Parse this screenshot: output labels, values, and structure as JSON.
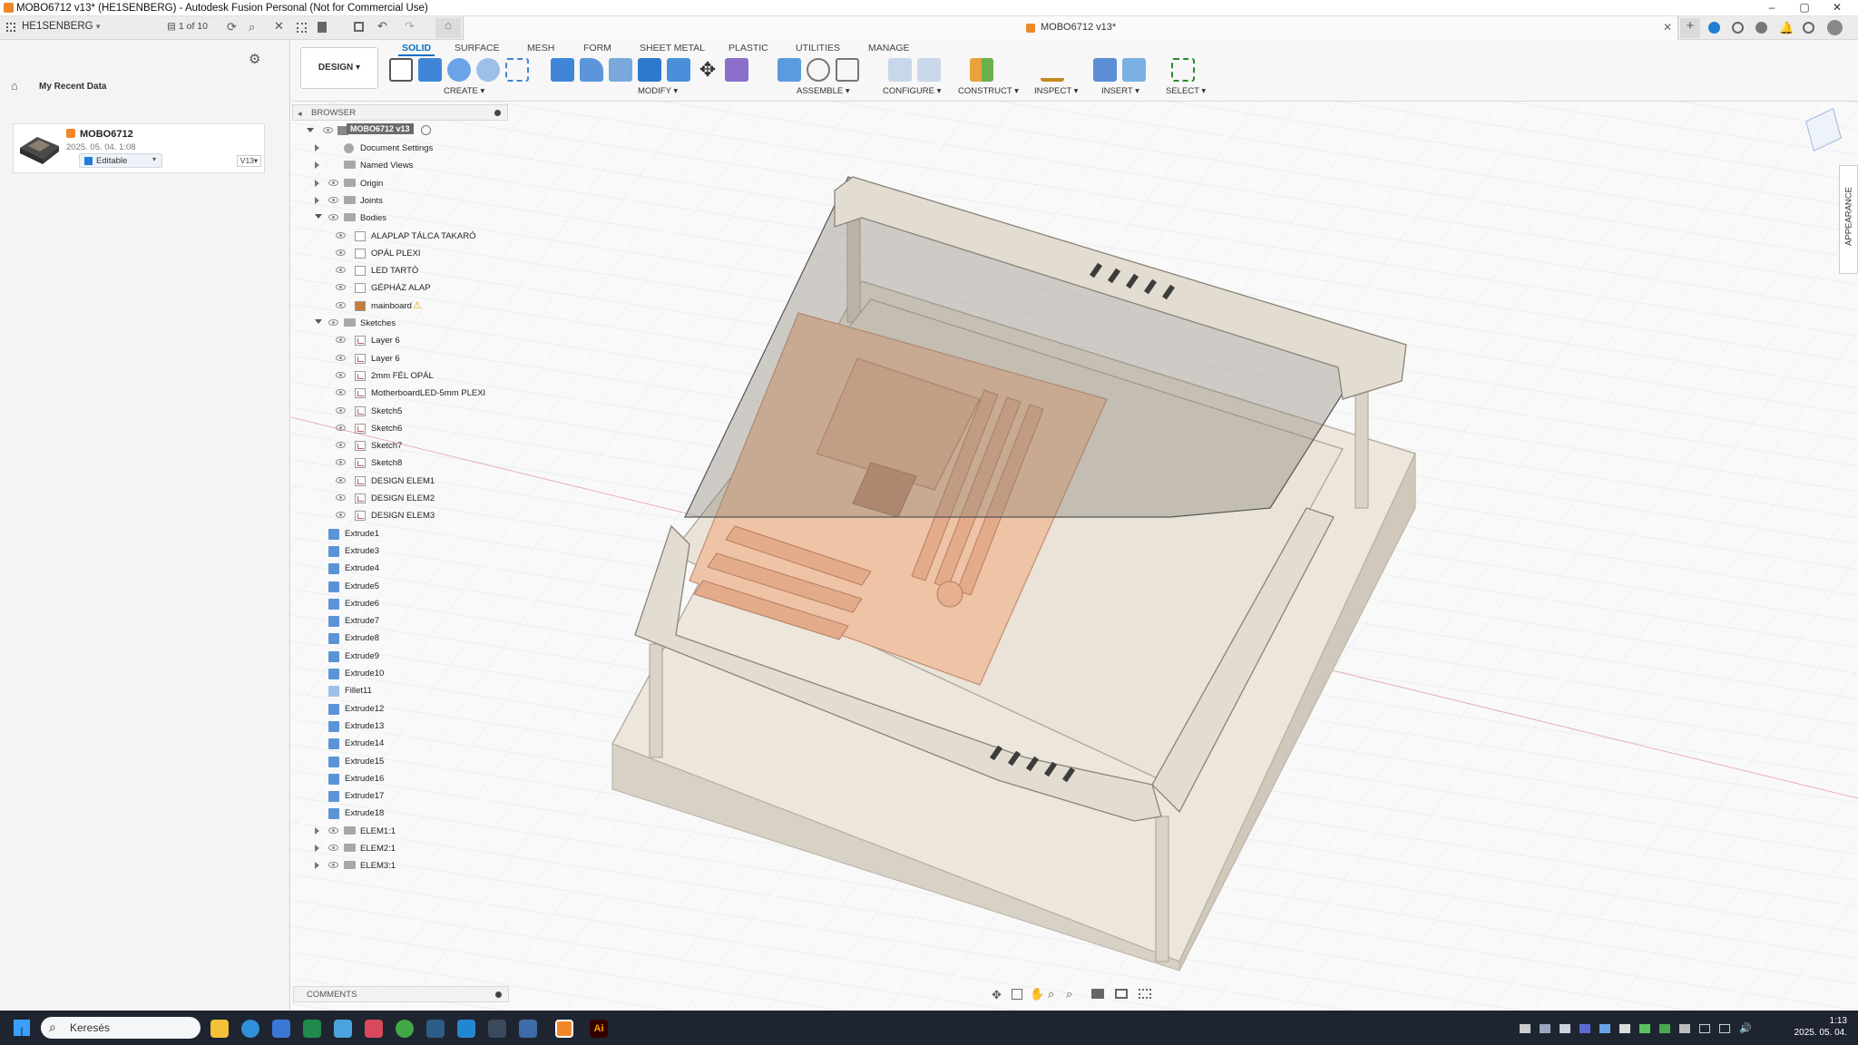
{
  "window": {
    "title": "MOBO6712 v13* (HE1SENBERG) - Autodesk Fusion Personal (Not for Commercial Use)",
    "controls": [
      "–",
      "▢",
      "✕"
    ]
  },
  "appbar": {
    "team": "HE1SENBERG",
    "page_counter": "1 of 10",
    "doc_tab": "MOBO6712 v13*"
  },
  "datapanel": {
    "breadcrumb": "My Recent Data",
    "card": {
      "name": "MOBO6712",
      "date": "2025. 05. 04. 1:08",
      "status": "Editable",
      "version": "V13"
    }
  },
  "toolbar": {
    "workspace": "DESIGN",
    "tabs": [
      "SOLID",
      "SURFACE",
      "MESH",
      "FORM",
      "SHEET METAL",
      "PLASTIC",
      "UTILITIES",
      "MANAGE"
    ],
    "active_tab": "SOLID",
    "groups": [
      "CREATE",
      "MODIFY",
      "ASSEMBLE",
      "CONFIGURE",
      "CONSTRUCT",
      "INSPECT",
      "INSERT",
      "SELECT"
    ]
  },
  "browser": {
    "title": "BROWSER",
    "root": "MOBO6712 v13",
    "items": [
      {
        "label": "Document Settings"
      },
      {
        "label": "Named Views"
      },
      {
        "label": "Origin"
      },
      {
        "label": "Joints"
      },
      {
        "label": "Bodies"
      },
      {
        "label": "ALAPLAP TÁLCA TAKARÓ"
      },
      {
        "label": "OPÁL PLEXI"
      },
      {
        "label": "LED TARTÓ"
      },
      {
        "label": "GÉPHÁZ ALAP"
      },
      {
        "label": "mainboard"
      },
      {
        "label": "Sketches"
      },
      {
        "label": "Layer 6"
      },
      {
        "label": "Layer 6"
      },
      {
        "label": "2mm FÉL OPÁL"
      },
      {
        "label": "MotherboardLED-5mm PLEXI"
      },
      {
        "label": "Sketch5"
      },
      {
        "label": "Sketch6"
      },
      {
        "label": "Sketch7"
      },
      {
        "label": "Sketch8"
      },
      {
        "label": "DESIGN ELEM1"
      },
      {
        "label": "DESIGN ELEM2"
      },
      {
        "label": "DESIGN ELEM3"
      },
      {
        "label": "Extrude1"
      },
      {
        "label": "Extrude3"
      },
      {
        "label": "Extrude4"
      },
      {
        "label": "Extrude5"
      },
      {
        "label": "Extrude6"
      },
      {
        "label": "Extrude7"
      },
      {
        "label": "Extrude8"
      },
      {
        "label": "Extrude9"
      },
      {
        "label": "Extrude10"
      },
      {
        "label": "Fillet11"
      },
      {
        "label": "Extrude12"
      },
      {
        "label": "Extrude13"
      },
      {
        "label": "Extrude14"
      },
      {
        "label": "Extrude15"
      },
      {
        "label": "Extrude16"
      },
      {
        "label": "Extrude17"
      },
      {
        "label": "Extrude18"
      },
      {
        "label": "ELEM1:1"
      },
      {
        "label": "ELEM2:1"
      },
      {
        "label": "ELEM3:1"
      }
    ]
  },
  "comments": {
    "title": "COMMENTS"
  },
  "appearance_panel": {
    "label": "APPEARANCE"
  },
  "taskbar": {
    "search_placeholder": "Keresés",
    "time": "1:13",
    "date": "2025. 05. 04."
  },
  "colors": {
    "accent": "#0a6fc2",
    "plate": "#e4ddd2",
    "board": "#eebfa2",
    "taskbar": "#1f2530"
  }
}
